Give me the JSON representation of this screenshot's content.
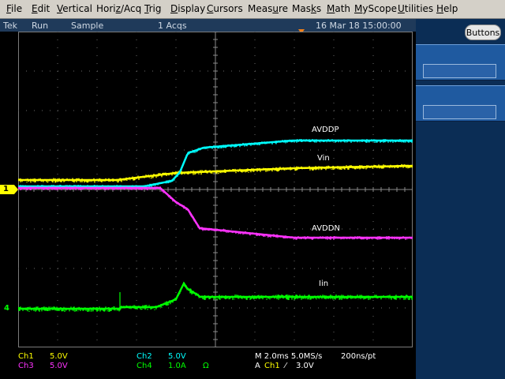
{
  "menu": [
    {
      "pre": "",
      "ul": "F",
      "post": "ile"
    },
    {
      "pre": "",
      "ul": "E",
      "post": "dit"
    },
    {
      "pre": "",
      "ul": "V",
      "post": "ertical"
    },
    {
      "pre": "Hori",
      "ul": "z",
      "post": "/Acq"
    },
    {
      "pre": "",
      "ul": "T",
      "post": "rig"
    },
    {
      "pre": "",
      "ul": "D",
      "post": "isplay"
    },
    {
      "pre": "",
      "ul": "C",
      "post": "ursors"
    },
    {
      "pre": "Meas",
      "ul": "u",
      "post": "re"
    },
    {
      "pre": "Mas",
      "ul": "k",
      "post": "s"
    },
    {
      "pre": "",
      "ul": "M",
      "post": "ath"
    },
    {
      "pre": "",
      "ul": "M",
      "post": "yScope"
    },
    {
      "pre": "",
      "ul": "U",
      "post": "tilities"
    },
    {
      "pre": "",
      "ul": "H",
      "post": "elp"
    }
  ],
  "status": {
    "brand": "Tek",
    "run_state": "Run",
    "acq_mode": "Sample",
    "acq_count": "1 Acqs",
    "datetime": "16 Mar 18 15:00:00"
  },
  "right_panel": {
    "buttons_label": "Buttons"
  },
  "markers": {
    "ch1": "1",
    "ch4": "4"
  },
  "waveform_labels": {
    "avddp": "AVDDP",
    "vin": "Vin",
    "avddn": "AVDDN",
    "iin": "Iin"
  },
  "readouts": {
    "ch1_name": "Ch1",
    "ch1_scale": "5.0V",
    "ch2_name": "Ch2",
    "ch2_scale": "5.0V",
    "ch3_name": "Ch3",
    "ch3_scale": "5.0V",
    "ch4_name": "Ch4",
    "ch4_scale": "1.0A",
    "ch4_term": "Ω",
    "horizontal": "M 2.0ms 5.0MS/s",
    "resolution": "200ns/pt",
    "trigger_prefix": "A",
    "trigger_source": "Ch1",
    "trigger_slope": "⁄",
    "trigger_level": "3.0V"
  },
  "colors": {
    "ch1": "#ffff00",
    "ch2": "#00ffff",
    "ch3": "#ff33ff",
    "ch4": "#00ff00",
    "menubar": "#d4d0c8",
    "statusbar": "#1f3a5a",
    "panel": "#0b2d55"
  }
}
